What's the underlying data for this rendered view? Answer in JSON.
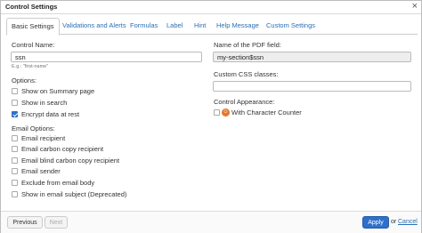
{
  "dialog": {
    "title": "Control Settings",
    "close_glyph": "×"
  },
  "tabs": [
    {
      "label": "Basic Settings",
      "active": true
    },
    {
      "label": "Validations and Alerts"
    },
    {
      "label": "Formulas"
    },
    {
      "label": "Label"
    },
    {
      "label": "Hint"
    },
    {
      "label": "Help Message"
    },
    {
      "label": "Custom Settings"
    }
  ],
  "left": {
    "control_name_label": "Control Name:",
    "control_name_value": "ssn",
    "control_name_hint": "E.g.: \"first-name\"",
    "options_label": "Options:",
    "options": [
      {
        "label": "Show on Summary page",
        "checked": false
      },
      {
        "label": "Show in search",
        "checked": false
      },
      {
        "label": "Encrypt data at rest",
        "checked": true
      }
    ],
    "email_options_label": "Email Options:",
    "email_options": [
      {
        "label": "Email recipient",
        "checked": false
      },
      {
        "label": "Email carbon copy recipient",
        "checked": false
      },
      {
        "label": "Email blind carbon copy recipient",
        "checked": false
      },
      {
        "label": "Email sender",
        "checked": false
      },
      {
        "label": "Exclude from email body",
        "checked": false
      },
      {
        "label": "Show in email subject (Deprecated)",
        "checked": false
      }
    ]
  },
  "right": {
    "pdf_field_label": "Name of the PDF field:",
    "pdf_field_value": "my-section$ssn",
    "css_label": "Custom CSS classes:",
    "css_value": "",
    "appearance_label": "Control Appearance:",
    "appearance_option": {
      "label": "With Character Counter",
      "checked": false,
      "icon": "character-counter-icon"
    }
  },
  "footer": {
    "previous_label": "Previous",
    "next_label": "Next",
    "apply_label": "Apply",
    "or_text": "or",
    "cancel_label": "Cancel"
  },
  "colors": {
    "accent": "#2f6fc9",
    "link": "#2a6fb6",
    "counter_icon": "#e8762c"
  }
}
